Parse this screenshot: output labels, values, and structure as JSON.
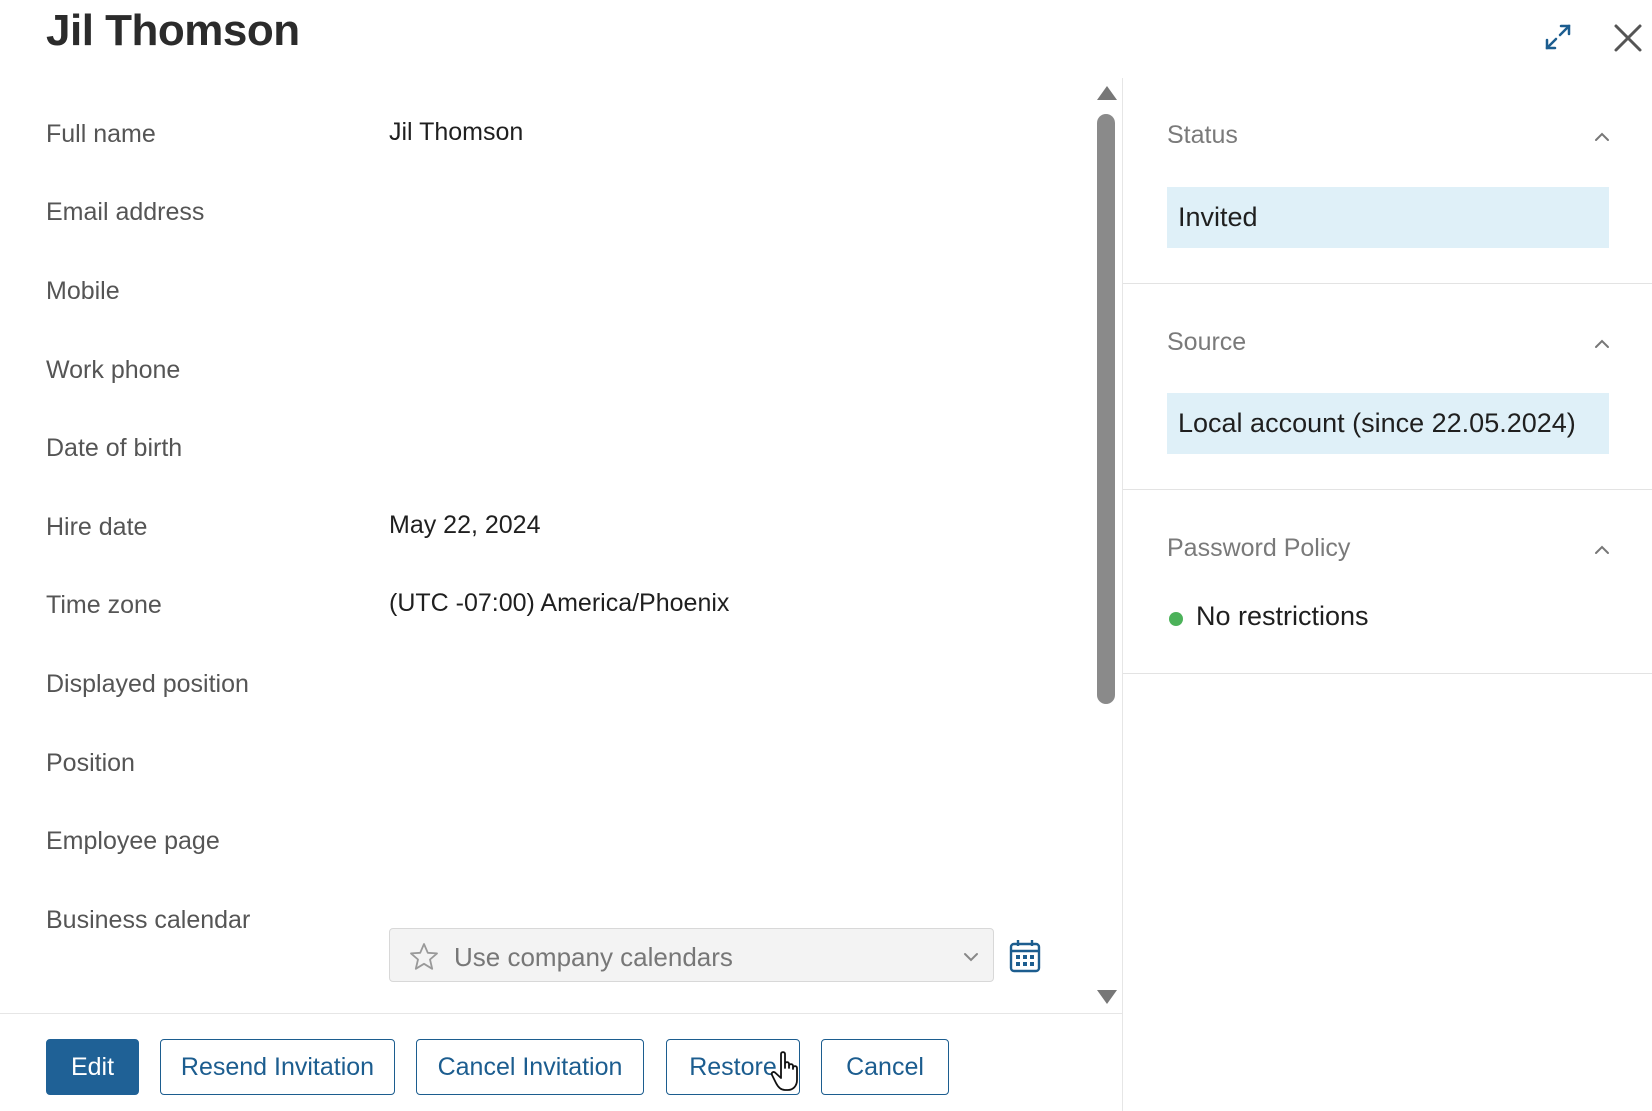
{
  "header": {
    "title": "Jil Thomson",
    "expand_icon": "expand-icon",
    "close_icon": "close-icon"
  },
  "fields": [
    {
      "label": "Full name",
      "value": "Jil Thomson"
    },
    {
      "label": "Email address",
      "value": ""
    },
    {
      "label": "Mobile",
      "value": ""
    },
    {
      "label": "Work phone",
      "value": ""
    },
    {
      "label": "Date of birth",
      "value": ""
    },
    {
      "label": "Hire date",
      "value": "May 22, 2024"
    },
    {
      "label": "Time zone",
      "value": "(UTC -07:00) America/Phoenix"
    },
    {
      "label": "Displayed position",
      "value": ""
    },
    {
      "label": "Position",
      "value": ""
    },
    {
      "label": "Employee page",
      "value": ""
    }
  ],
  "business_calendar": {
    "label": "Business calendar",
    "selected": "Use company calendars",
    "icons": [
      "star-icon",
      "chevron-down-icon",
      "calendar-icon"
    ]
  },
  "sidebar": {
    "status": {
      "title": "Status",
      "value": "Invited"
    },
    "source": {
      "title": "Source",
      "value": "Local account (since 22.05.2024)"
    },
    "password_policy": {
      "title": "Password Policy",
      "value": "No restrictions",
      "indicator_color": "#4cb25a"
    }
  },
  "footer": {
    "edit_label": "Edit",
    "resend_label": "Resend Invitation",
    "cancel_invitation_label": "Cancel Invitation",
    "restore_label": "Restore",
    "cancel_label": "Cancel"
  },
  "colors": {
    "primary": "#1f6196",
    "info_box_bg": "#dff0f8",
    "status_green": "#4cb25a"
  }
}
